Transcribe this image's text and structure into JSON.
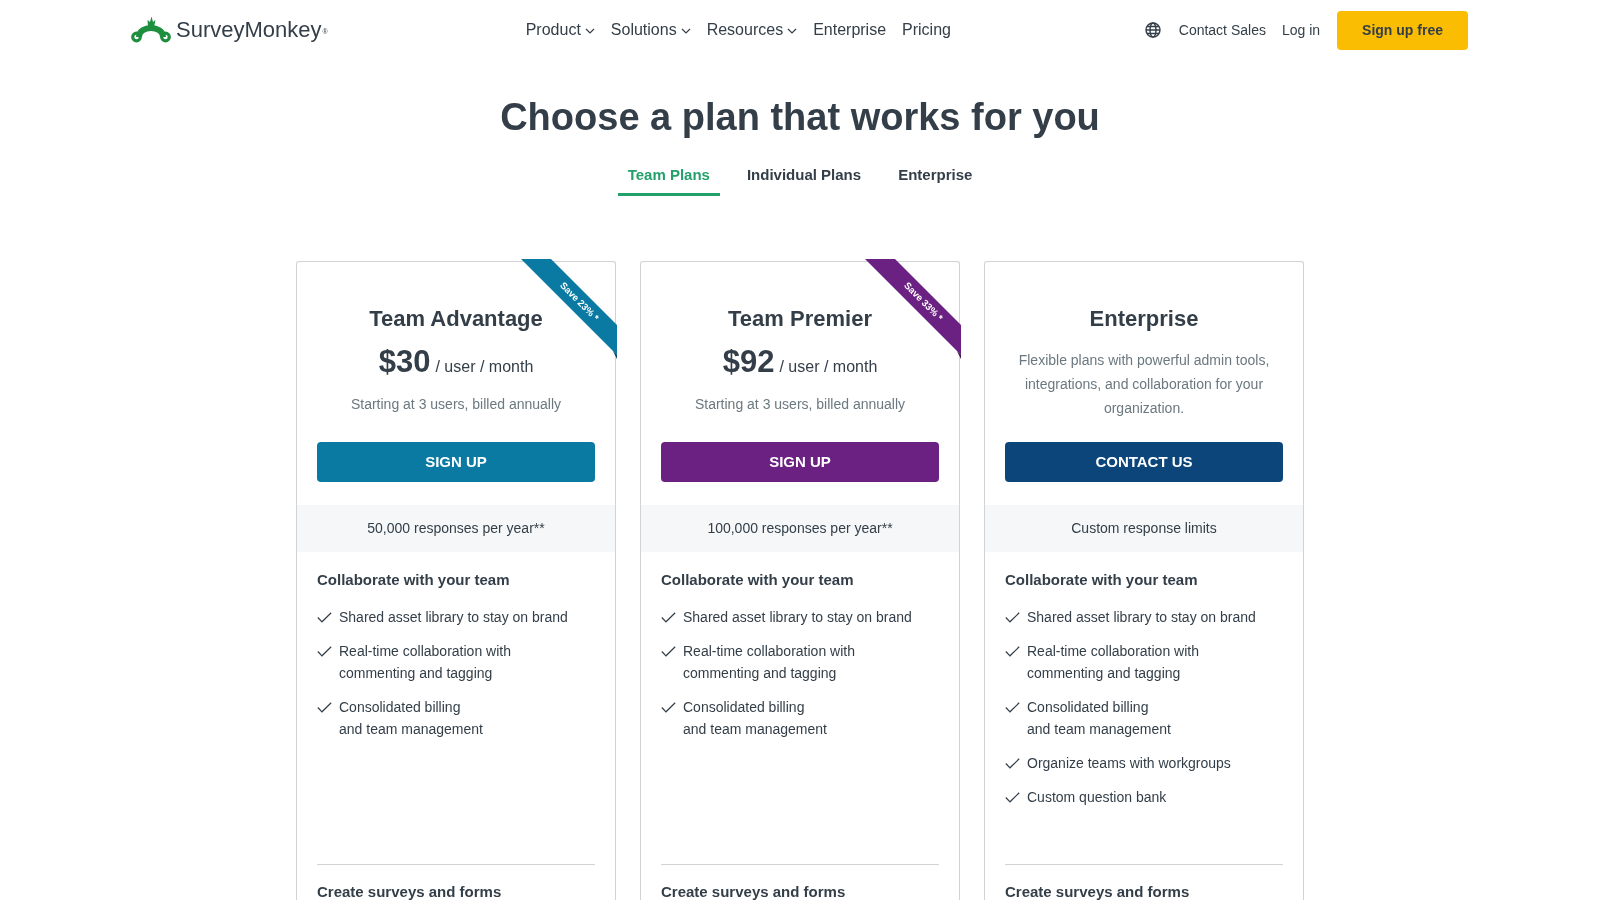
{
  "header": {
    "logo": "SurveyMonkey$^{®}$",
    "nav": [
      {
        "label": "Product",
        "dropdown": true
      },
      {
        "label": "Solutions",
        "dropdown": true
      },
      {
        "label": "Resources",
        "dropdown": true
      },
      {
        "label": "Enterprise",
        "dropdown": false
      },
      {
        "label": "Pricing",
        "dropdown": false
      }
    ],
    "links": [
      "Contact Sales",
      "Log in"
    ],
    "cta": "Sign up free"
  },
  "page_title": "Choose a plan that works for you",
  "tabs": [
    {
      "label": "Team Plans",
      "selected": true
    },
    {
      "label": "Individual Plans",
      "selected": false
    },
    {
      "label": "Enterprise",
      "selected": false
    }
  ],
  "plans": [
    {
      "kind": "priced",
      "name": "Team Advantage",
      "price": "$30",
      "price_unit": "/ user / month",
      "billing_note": "Starting at 3 users, billed annually",
      "ribbon": "Save 23% *",
      "color": "#0a7aa3",
      "button": "SIGN UP",
      "responses": "50,000 responses per year**",
      "sections": [
        {
          "title": "Collaborate with your team",
          "features": [
            "Shared asset library to stay on brand",
            "Real-time collaboration with\ncommenting and tagging",
            "Consolidated billing\nand team management"
          ]
        },
        {
          "title": "Create surveys and forms"
        }
      ]
    },
    {
      "kind": "priced",
      "name": "Team Premier",
      "price": "$92",
      "price_unit": "/ user / month",
      "billing_note": "Starting at 3 users, billed annually",
      "ribbon": "Save 33% *",
      "color": "#6b2182",
      "button": "SIGN UP",
      "responses": "100,000 responses per year**",
      "sections": [
        {
          "title": "Collaborate with your team",
          "features": [
            "Shared asset library to stay on brand",
            "Real-time collaboration with\ncommenting and tagging",
            "Consolidated billing\nand team management"
          ]
        },
        {
          "title": "Create surveys and forms"
        }
      ]
    },
    {
      "kind": "custom",
      "name": "Enterprise",
      "description": "Flexible plans with powerful admin tools, integrations, and collaboration for your organization.",
      "color": "#0b457a",
      "button": "CONTACT US",
      "responses": "Custom response limits",
      "sections": [
        {
          "title": "Collaborate with your team",
          "features": [
            "Shared asset library to stay on brand",
            "Real-time collaboration with\ncommenting and tagging",
            "Consolidated billing\nand team management",
            "Organize teams with workgroups",
            "Custom question bank"
          ]
        },
        {
          "title": "Create surveys and forms"
        }
      ]
    }
  ]
}
